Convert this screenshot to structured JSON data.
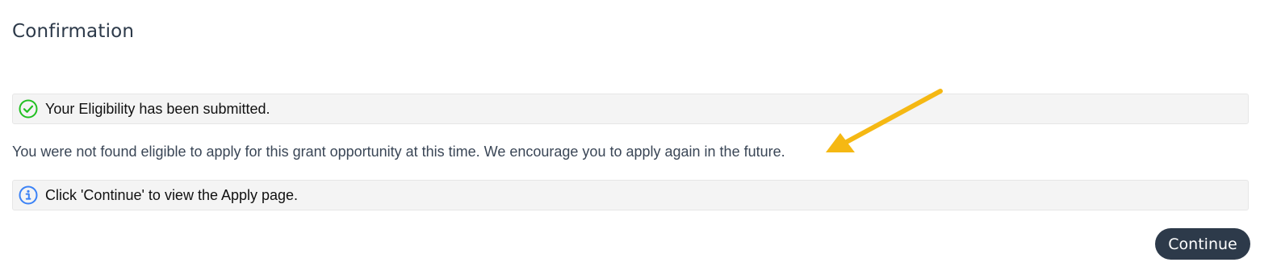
{
  "header": {
    "title": "Confirmation"
  },
  "success_banner": {
    "icon": "check-circle-icon",
    "text": "Your Eligibility has been submitted.",
    "color": "#22c022"
  },
  "message": {
    "text": "You were not found eligible to apply for this grant opportunity at this time. We encourage you to apply again in the future."
  },
  "info_banner": {
    "icon": "info-circle-icon",
    "text": "Click 'Continue' to view the Apply page.",
    "color": "#3b82f6"
  },
  "actions": {
    "continue_label": "Continue"
  },
  "annotation": {
    "icon": "arrow-annotation-icon",
    "color": "#f5b813"
  },
  "colors": {
    "primary": "#2d3a4a",
    "banner_bg": "#f4f4f4"
  }
}
